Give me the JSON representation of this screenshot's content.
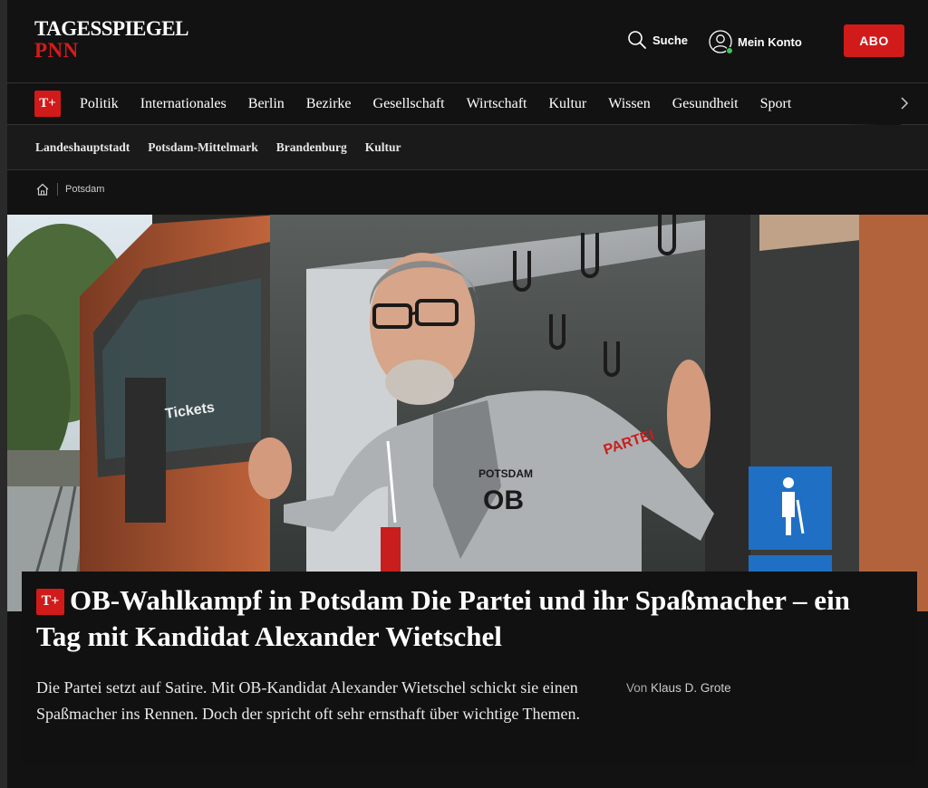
{
  "header": {
    "logo_main": "TAGESSPIEGEL",
    "logo_sub": "PNN",
    "search_label": "Suche",
    "account_label": "Mein Konto",
    "abo_label": "ABO",
    "brand_color": "#d11a1a",
    "online_color": "#43c35a"
  },
  "main_nav": {
    "badge": "T+",
    "items": [
      "Politik",
      "Internationales",
      "Berlin",
      "Bezirke",
      "Gesellschaft",
      "Wirtschaft",
      "Kultur",
      "Wissen",
      "Gesundheit",
      "Sport"
    ]
  },
  "sub_nav": {
    "items": [
      "Landeshauptstadt",
      "Potsdam-Mittelmark",
      "Brandenburg",
      "Kultur"
    ]
  },
  "breadcrumb": {
    "current": "Potsdam"
  },
  "article": {
    "badge": "T+",
    "kicker": "OB-Wahlkampf in Potsdam",
    "title": "Die Partei und ihr Spaßmacher – ein Tag mit Kandidat Alexander Wietschel",
    "teaser": "Die Partei setzt auf Satire. Mit OB-Kandidat Alexander Wietschel schickt sie einen Spaßmacher ins Rennen. Doch der spricht oft sehr ernsthaft über wichtige Themen.",
    "author_prefix": "Von",
    "author_name": "Klaus D. Grote",
    "hero": {
      "sign_text": "Tickets",
      "shirt_text_1": "POTSDAM",
      "shirt_text_2": "OB",
      "sleeve_text": "PARTEI"
    }
  }
}
